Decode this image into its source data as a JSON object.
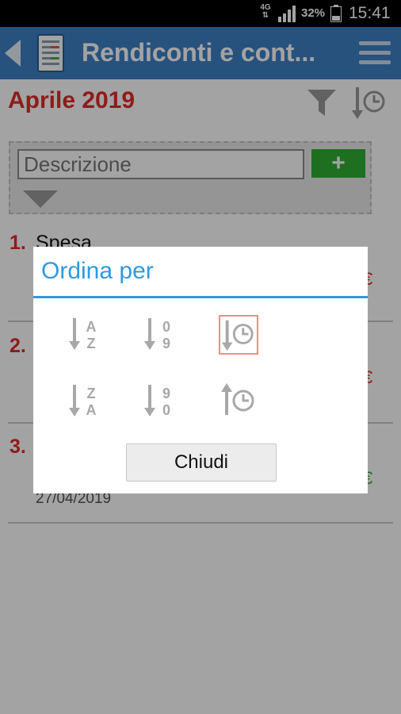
{
  "status_bar": {
    "network_top": "4G",
    "network_bottom": "⇅",
    "battery": "32%",
    "time": "15:41"
  },
  "app_bar": {
    "title": "Rendiconti e cont...",
    "color": "#3d81c6",
    "icons": [
      "back-icon",
      "document-icon",
      "menu-icon"
    ]
  },
  "content": {
    "month": "Aprile 2019",
    "header_icons": [
      "filter-icon",
      "sort-by-date-icon"
    ],
    "entry": {
      "description_placeholder": "Descrizione",
      "add_label": "+"
    },
    "items": [
      {
        "number": "1.",
        "description": "Spesa",
        "amount": "€",
        "amount_color": "#e02b2b"
      },
      {
        "number": "2.",
        "description": "",
        "amount": "€",
        "amount_color": "#e02b2b"
      },
      {
        "number": "3.",
        "description": "",
        "amount": "€",
        "amount_color": "#2fae33",
        "date": "27/04/2019"
      }
    ]
  },
  "sort_dialog": {
    "title": "Ordina per",
    "options": [
      {
        "name": "alphabetical-ascending",
        "top": "A",
        "bottom": "Z"
      },
      {
        "name": "numeric-ascending",
        "top": "0",
        "bottom": "9"
      },
      {
        "name": "date-descending",
        "selected": true
      },
      {
        "name": "alphabetical-descending",
        "top": "Z",
        "bottom": "A"
      },
      {
        "name": "numeric-descending",
        "top": "9",
        "bottom": "0"
      },
      {
        "name": "date-ascending"
      }
    ],
    "close_label": "Chiudi"
  }
}
